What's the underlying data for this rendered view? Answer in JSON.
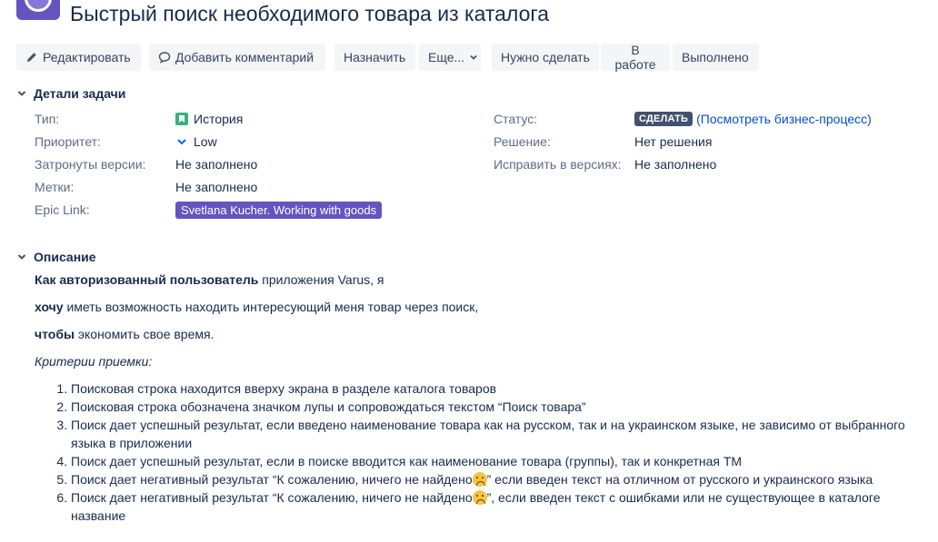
{
  "issue": {
    "title": "Быстрый поиск необходимого товара из каталога"
  },
  "toolbar": {
    "edit_label": "Редактировать",
    "comment_label": "Добавить комментарий",
    "assign_label": "Назначить",
    "more_label": "Еще...",
    "todo_label": "Нужно сделать",
    "inprogress_label": "В работе",
    "done_label": "Выполнено"
  },
  "details": {
    "heading": "Детали задачи",
    "type_label": "Тип:",
    "type_value": "История",
    "priority_label": "Приоритет:",
    "priority_value": "Low",
    "affects_label": "Затронуты версии:",
    "affects_value": "Не заполнено",
    "labels_label": "Метки:",
    "labels_value": "Не заполнено",
    "epic_label": "Epic Link:",
    "epic_value": "Svetlana Kucher. Working with goods",
    "status_label": "Статус:",
    "status_value": "СДЕЛАТЬ",
    "workflow_open": "(",
    "workflow_link": "Посмотреть бизнес-процесс",
    "workflow_close": ")",
    "resolution_label": "Решение:",
    "resolution_value": "Нет решения",
    "fix_label": "Исправить в версиях:",
    "fix_value": "Не заполнено"
  },
  "description": {
    "heading": "Описание",
    "line1_bold": "Как авторизованный пользователь",
    "line1_rest": " приложения Varus, я",
    "line2_bold": "хочу",
    "line2_rest": " иметь возможность находить интересующий меня товар через поиск,",
    "line3_bold": "чтобы",
    "line3_rest": " экономить свое время.",
    "criteria_title": "Критерии приемки:",
    "criteria": [
      "Поисковая строка находится вверху экрана в разделе каталога товаров",
      "Поисковая строка обозначена значком лупы и сопровождаться текстом “Поиск товара”",
      "Поиск дает успешный результат, если введено наименование товара как на русском, так и на украинском языке, не зависимо от выбранного языка в приложении",
      "Поиск дает успешный результат, если в поиске вводится как наименование товара (группы), так и конкретная ТМ"
    ],
    "criteria5_a": "Поиск дает негативный результат “К сожалению, ничего не найдено",
    "criteria5_b": "” если введен текст на отличном от русского и украинского языка",
    "criteria6_a": "Поиск дает негативный результат “К сожалению, ничего не найдено",
    "criteria6_b": "”, если введен текст с ошибками или не существующее в каталоге название"
  },
  "colors": {
    "accent": "#0052cc",
    "epic": "#6554c0",
    "status_badge": "#42526e",
    "story_icon": "#36b37e",
    "low_priority": "#0065ff"
  },
  "icons": [
    "pencil-icon",
    "comment-icon",
    "chevron-down-icon",
    "story-icon",
    "low-priority-icon",
    "sad-face-icon"
  ]
}
